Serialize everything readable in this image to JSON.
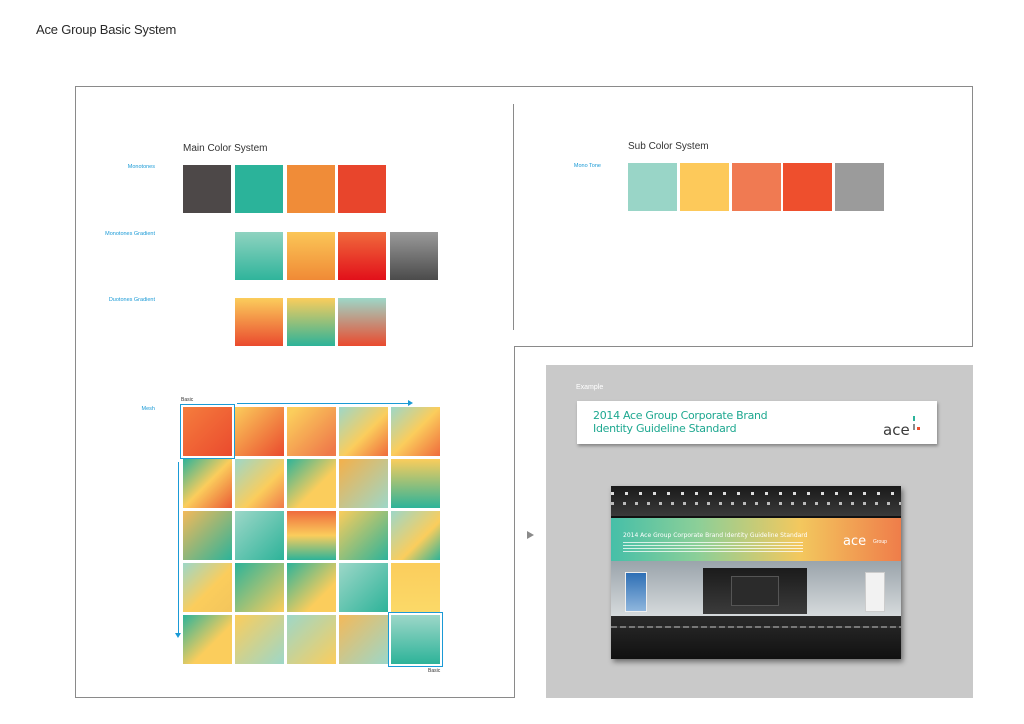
{
  "page": {
    "title": "Ace Group Basic System"
  },
  "main_color": {
    "title": "Main Color System",
    "rows": {
      "monotones": "Monotones",
      "monotones_gradient": "Monotones Gradient",
      "duotones_gradient": "Duotones Gradient",
      "mesh": "Mesh"
    },
    "mesh_basic_top": "Basic",
    "mesh_basic_bottom": "Basic"
  },
  "sub_color": {
    "title": "Sub Color System",
    "row_label": "Mono Tone"
  },
  "colors": {
    "charcoal": "#4d4848",
    "teal": "#2bb39a",
    "orange": "#f08c38",
    "red_orange": "#e8452c",
    "mint": "#99d5c7",
    "yellow": "#fdc95a",
    "coral": "#f07a52",
    "red": "#ee4f2d",
    "gray": "#9b9b9b",
    "accent_blue": "#1a9ad6"
  },
  "example": {
    "label": "Example",
    "banner_line1": "2014 Ace Group Corporate Brand",
    "banner_line2": "Identity Guideline Standard",
    "logo_word": "ace",
    "logo_sub": "Group",
    "stage_title": "2014 Ace Group Corporate Brand Identity Guideline Standard",
    "stage_logo": "ace",
    "stage_logo_sub": "Group"
  },
  "icons": {
    "arrow": "play-arrow-icon"
  }
}
